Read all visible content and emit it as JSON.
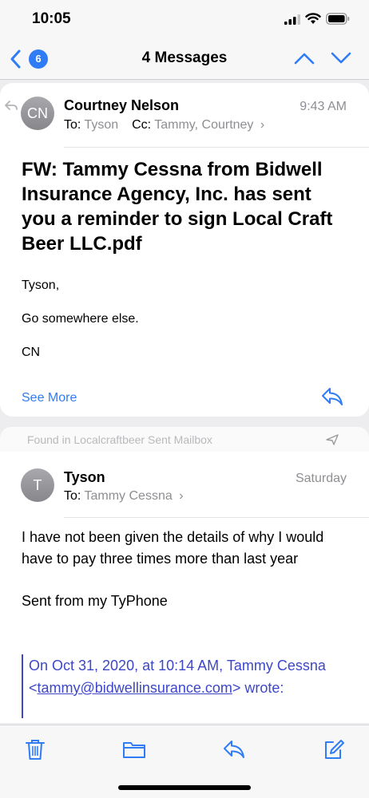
{
  "status_bar": {
    "time": "10:05"
  },
  "nav": {
    "badge_count": "6",
    "title": "4 Messages"
  },
  "message1": {
    "avatar_initials": "CN",
    "sender": "Courtney Nelson",
    "to_label": "To:",
    "to_value": "Tyson",
    "cc_label": "Cc:",
    "cc_value": "Tammy, Courtney",
    "time": "9:43 AM",
    "subject": "FW: Tammy Cessna from Bidwell Insurance Agency, Inc. has sent you a reminder to sign Local Craft Beer LLC.pdf",
    "body_lines": [
      "Tyson,",
      "Go somewhere else.",
      "CN"
    ],
    "see_more": "See More"
  },
  "found_in": {
    "text": "Found in Localcraftbeer Sent Mailbox"
  },
  "message2": {
    "avatar_initials": "T",
    "sender": "Tyson",
    "to_label": "To:",
    "to_value": "Tammy Cessna",
    "time": "Saturday",
    "body": "I have not been given the details of why I would have to pay three times more than last year",
    "signature": "Sent from my TyPhone",
    "quote_prefix": "On Oct 31, 2020, at 10:14 AM, Tammy Cessna",
    "quote_email": "tammy@bidwellinsurance.com",
    "quote_suffix": "wrote:"
  },
  "colors": {
    "accent": "#2f7cf6",
    "quote": "#3d47c7",
    "secondary_text": "#8e8e93"
  },
  "icons": [
    "back-chevron-icon",
    "chevron-up-icon",
    "chevron-down-icon",
    "reply-icon",
    "send-icon",
    "trash-icon",
    "folder-icon",
    "compose-icon"
  ]
}
